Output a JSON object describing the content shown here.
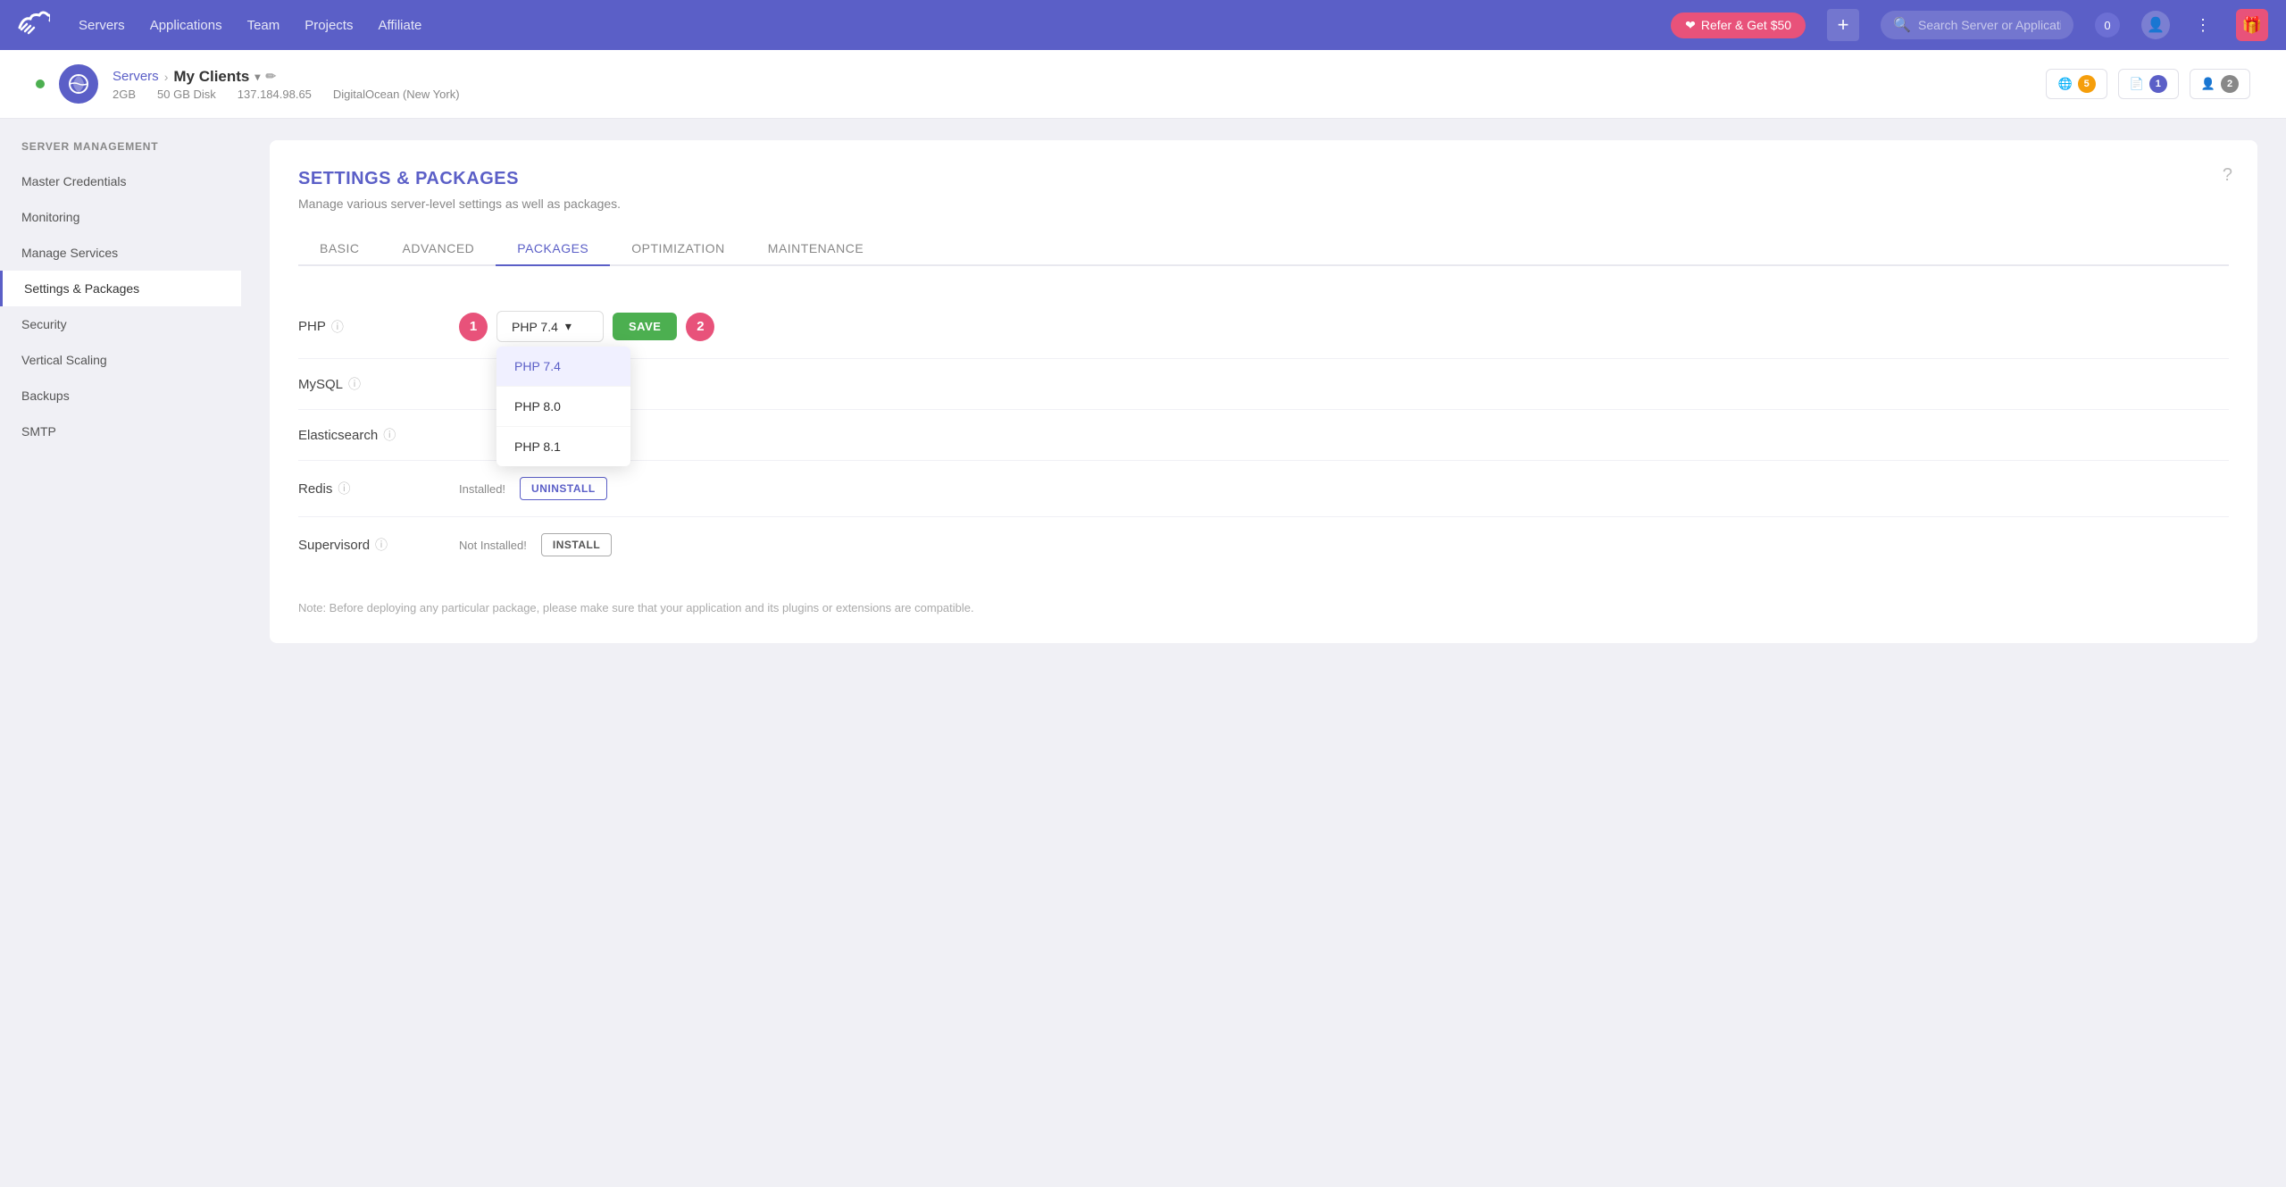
{
  "nav": {
    "logo": "☁",
    "links": [
      "Servers",
      "Applications",
      "Team",
      "Projects",
      "Affiliate"
    ],
    "refer_label": "Refer & Get $50",
    "plus_label": "+",
    "search_placeholder": "Search Server or Application",
    "notification_count": "0",
    "dots": "⋮",
    "gift": "🎁"
  },
  "server_header": {
    "servers_link": "Servers",
    "arrow": "›",
    "server_name": "My Clients",
    "dropdown_arrow": "▾",
    "edit_icon": "✏",
    "ram": "2GB",
    "disk": "50 GB Disk",
    "ip": "137.184.98.65",
    "provider": "DigitalOcean (New York)",
    "stats": [
      {
        "icon": "🌐",
        "count": "5",
        "color": "orange"
      },
      {
        "icon": "📄",
        "count": "1",
        "color": "blue"
      },
      {
        "icon": "👤",
        "count": "2",
        "color": "gray"
      }
    ]
  },
  "sidebar": {
    "section_title": "Server Management",
    "items": [
      {
        "label": "Master Credentials",
        "active": false
      },
      {
        "label": "Monitoring",
        "active": false
      },
      {
        "label": "Manage Services",
        "active": false
      },
      {
        "label": "Settings & Packages",
        "active": true
      },
      {
        "label": "Security",
        "active": false
      },
      {
        "label": "Vertical Scaling",
        "active": false
      },
      {
        "label": "Backups",
        "active": false
      },
      {
        "label": "SMTP",
        "active": false
      }
    ]
  },
  "content": {
    "title": "SETTINGS & PACKAGES",
    "subtitle": "Manage various server-level settings as well as packages.",
    "tabs": [
      "BASIC",
      "ADVANCED",
      "PACKAGES",
      "OPTIMIZATION",
      "MAINTENANCE"
    ],
    "active_tab": "PACKAGES"
  },
  "packages": {
    "rows": [
      {
        "label": "PHP",
        "has_dropdown": true,
        "selected": "PHP 7.4",
        "options": [
          "PHP 7.4",
          "PHP 8.0",
          "PHP 8.1"
        ]
      },
      {
        "label": "MySQL",
        "has_dropdown": false
      },
      {
        "label": "Elasticsearch",
        "has_dropdown": false
      },
      {
        "label": "Redis",
        "installed": true,
        "installed_label": "Installed!",
        "action_label": "UNINSTALL"
      },
      {
        "label": "Supervisord",
        "installed": false,
        "not_installed_label": "Not Installed!",
        "action_label": "INSTALL"
      }
    ],
    "note": "Note: Before deploying any particular package, please make sure that your application and its plugins or extensions are compatible.",
    "save_label": "SAVE",
    "close_label": "×",
    "step1": "1",
    "step2": "2"
  }
}
